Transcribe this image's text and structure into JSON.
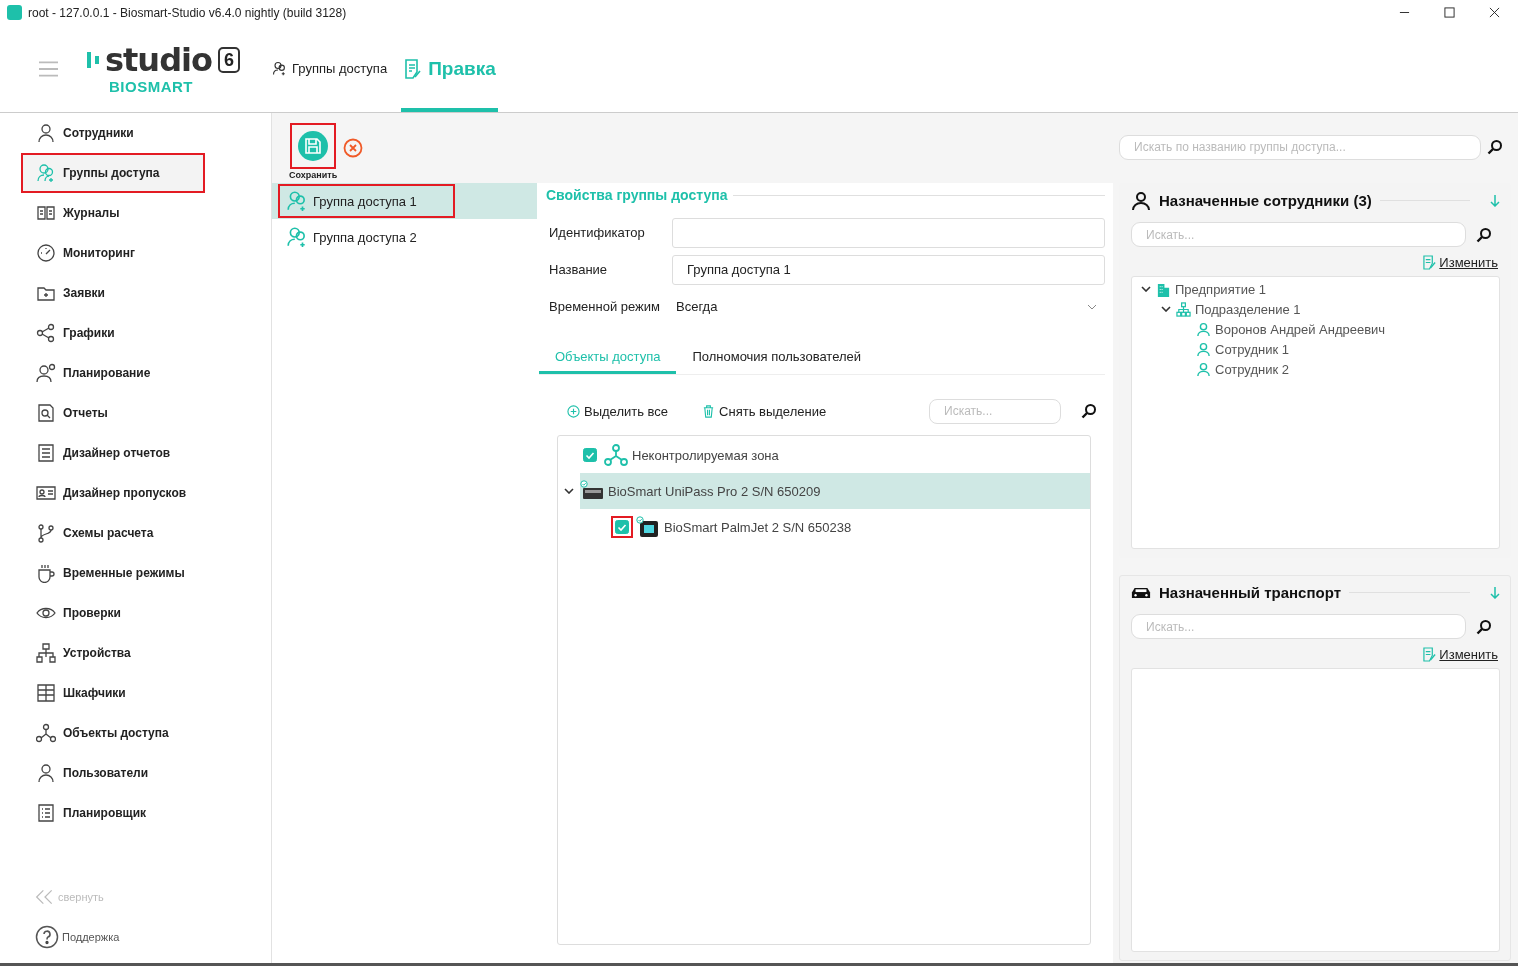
{
  "window": {
    "title": "root - 127.0.0.1 - Biosmart-Studio v6.4.0 nightly (build 3128)"
  },
  "logo": {
    "name": "studio",
    "version": "6",
    "brand": "BIOSMART"
  },
  "breadcrumbs": [
    {
      "label": "Группы доступа",
      "selected": false
    },
    {
      "label": "Правка",
      "selected": true
    }
  ],
  "sidebar": {
    "items": [
      {
        "label": "Сотрудники",
        "selected": false,
        "highlighted": false
      },
      {
        "label": "Группы доступа",
        "selected": true,
        "highlighted": true
      },
      {
        "label": "Журналы",
        "selected": false,
        "highlighted": false
      },
      {
        "label": "Мониторинг",
        "selected": false,
        "highlighted": false
      },
      {
        "label": "Заявки",
        "selected": false,
        "highlighted": false
      },
      {
        "label": "Графики",
        "selected": false,
        "highlighted": false
      },
      {
        "label": "Планирование",
        "selected": false,
        "highlighted": false
      },
      {
        "label": "Отчеты",
        "selected": false,
        "highlighted": false
      },
      {
        "label": "Дизайнер отчетов",
        "selected": false,
        "highlighted": false
      },
      {
        "label": "Дизайнер пропусков",
        "selected": false,
        "highlighted": false
      },
      {
        "label": "Схемы расчета",
        "selected": false,
        "highlighted": false
      },
      {
        "label": "Временные режимы",
        "selected": false,
        "highlighted": false
      },
      {
        "label": "Проверки",
        "selected": false,
        "highlighted": false
      },
      {
        "label": "Устройства",
        "selected": false,
        "highlighted": false
      },
      {
        "label": "Шкафчики",
        "selected": false,
        "highlighted": false
      },
      {
        "label": "Объекты доступа",
        "selected": false,
        "highlighted": false
      },
      {
        "label": "Пользователи",
        "selected": false,
        "highlighted": false
      },
      {
        "label": "Планировщик",
        "selected": false,
        "highlighted": false
      }
    ],
    "collapse": "свернуть",
    "support": "Поддержка"
  },
  "toolbar": {
    "save": {
      "label": "Сохранить",
      "highlighted": true
    }
  },
  "groups": [
    {
      "label": "Группа доступа 1",
      "selected": true,
      "highlighted": true
    },
    {
      "label": "Группа доступа 2",
      "selected": false,
      "highlighted": false
    }
  ],
  "properties": {
    "title": "Свойства группы доступа",
    "fields": [
      {
        "label": "Идентификатор",
        "kind": "input"
      },
      {
        "label": "Название",
        "kind": "input",
        "value": "Группа доступа 1"
      },
      {
        "label": "Временной режим",
        "kind": "select",
        "value": "Всегда"
      }
    ]
  },
  "tabs": [
    {
      "label": "Объекты доступа",
      "selected": true
    },
    {
      "label": "Полномочия пользователей",
      "selected": false
    }
  ],
  "object_actions": [
    "Выделить все",
    "Снять выделение"
  ],
  "object_search": {
    "placeholder": "Искать..."
  },
  "objects": [
    {
      "label": "Неконтролируемая зона",
      "kind": "zone",
      "checked": true
    },
    {
      "label": "BioSmart UniPass Pro 2 S/N 650209",
      "kind": "terminal",
      "selected": true,
      "expanded": true,
      "children": [
        {
          "label": "BioSmart PalmJet 2 S/N 650238",
          "kind": "scanner",
          "checked": true,
          "highlighted": true
        }
      ]
    }
  ],
  "group_search": {
    "placeholder": "Искать по названию группы доступа..."
  },
  "employees": {
    "title": "Назначенные сотрудники (3)",
    "search": {
      "placeholder": "Искать..."
    },
    "edit": "Изменить",
    "tree": [
      {
        "label": "Предприятие 1",
        "kind": "company",
        "expanded": true,
        "children": [
          {
            "label": "Подразделение 1",
            "kind": "department",
            "expanded": true,
            "children": [
              {
                "label": "Воронов Андрей Андреевич",
                "kind": "person"
              },
              {
                "label": "Сотрудник 1",
                "kind": "person"
              },
              {
                "label": "Сотрудник 2",
                "kind": "person"
              }
            ]
          }
        ]
      }
    ]
  },
  "transport": {
    "title": "Назначенный транспорт",
    "search": {
      "placeholder": "Искать..."
    },
    "edit": "Изменить"
  }
}
